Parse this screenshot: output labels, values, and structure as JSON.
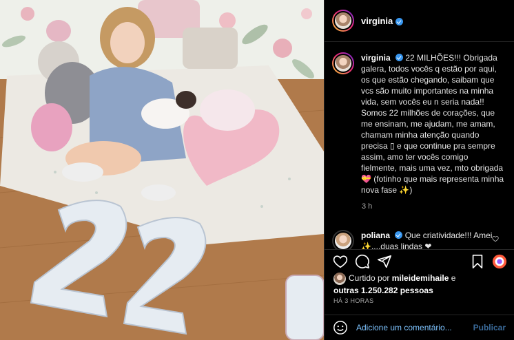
{
  "colors": {
    "panel_bg": "#000000",
    "verified": "#3897f0",
    "link": "#b3d7ff",
    "placeholder": "#7ec4ff",
    "muted": "#a8a8a8"
  },
  "header": {
    "username": "virginia"
  },
  "caption": {
    "username": "virginia",
    "text": "22 MILHÕES!!! Obrigada galera, todos vocês q estão por aqui, os que estão chegando, saibam que vcs são muito importantes na minha vida, sem vocês eu n seria nada!! Somos 22 milhões de corações, que me ensinam, me ajudam, me amam, chamam minha atenção quando precisa ▯ e que continue pra sempre assim, amo ter vocês comigo fielmente, mais uma vez, mto obrigada 💝 (fotinho que mais representa minha nova fase ✨)",
    "time": "3 h"
  },
  "comment": {
    "username": "poliana",
    "text": "Que criatividade!!! Amei ✨....duas lindas ❤"
  },
  "likes": {
    "prefix": "Curtido por",
    "user": "mileidemihaile",
    "joiner": "e",
    "others": "outras 1.250.282 pessoas"
  },
  "posted_ago": "HÁ 3 HORAS",
  "add_comment": {
    "placeholder": "Adicione um comentário...",
    "post_label": "Publicar"
  },
  "icons": [
    "heart-icon",
    "comment-icon",
    "share-icon",
    "bookmark-icon",
    "emoji-icon"
  ]
}
